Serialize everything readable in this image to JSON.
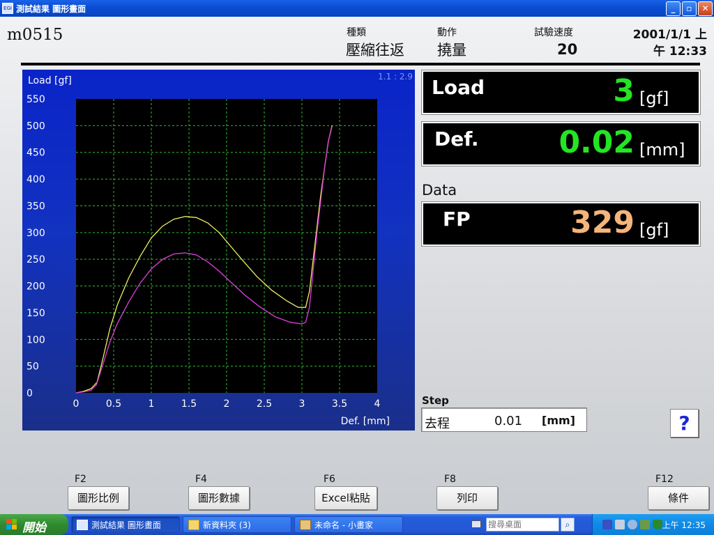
{
  "window": {
    "title": "測試結果  圖形畫面",
    "app_icon_text": "EGI",
    "minimize": "_",
    "restore": "▫",
    "close": "✕"
  },
  "header": {
    "sample_name": "m0515",
    "type_label": "種類",
    "type_value": "壓縮往返",
    "action_label": "動作",
    "action_value": "撓量",
    "speed_label": "試驗速度",
    "speed_value": "20",
    "date_line1": "2001/1/1 上",
    "date_line2": "午 12:33"
  },
  "chart_data": {
    "type": "line",
    "ylabel": "Load [gf]",
    "xlabel": "Def. [mm]",
    "ratio_label": "1.1 : 2.9",
    "ylim": [
      0,
      550
    ],
    "xlim": [
      0,
      4
    ],
    "yticks": [
      "0",
      "50",
      "100",
      "150",
      "200",
      "250",
      "300",
      "350",
      "400",
      "450",
      "500",
      "550"
    ],
    "xticks": [
      "0",
      "0.5",
      "1",
      "1.5",
      "2",
      "2.5",
      "3",
      "3.5",
      "4"
    ],
    "grid": true,
    "series": [
      {
        "color": "#f0f060",
        "x": [
          0,
          0.1,
          0.2,
          0.28,
          0.35,
          0.45,
          0.55,
          0.7,
          0.85,
          1.0,
          1.15,
          1.3,
          1.45,
          1.6,
          1.75,
          1.9,
          2.05,
          2.2,
          2.4,
          2.6,
          2.8,
          2.95,
          3.05,
          3.1,
          3.15,
          3.2,
          3.25,
          3.3,
          3.35,
          3.4
        ],
        "y": [
          0,
          3,
          8,
          20,
          60,
          120,
          165,
          215,
          255,
          290,
          312,
          325,
          330,
          328,
          318,
          300,
          275,
          250,
          218,
          192,
          172,
          160,
          160,
          190,
          250,
          310,
          370,
          420,
          470,
          500
        ]
      },
      {
        "color": "#e040e0",
        "x": [
          0,
          0.1,
          0.2,
          0.27,
          0.35,
          0.45,
          0.55,
          0.7,
          0.85,
          1.0,
          1.15,
          1.3,
          1.45,
          1.6,
          1.75,
          1.9,
          2.05,
          2.25,
          2.45,
          2.65,
          2.85,
          3.0,
          3.05,
          3.1,
          3.15,
          3.2,
          3.25,
          3.3,
          3.35,
          3.4
        ],
        "y": [
          0,
          2,
          5,
          15,
          50,
          95,
          130,
          170,
          205,
          232,
          250,
          260,
          262,
          258,
          245,
          228,
          208,
          182,
          160,
          142,
          132,
          129,
          132,
          160,
          230,
          300,
          360,
          420,
          470,
          498
        ]
      }
    ]
  },
  "readouts": {
    "load": {
      "name": "Load",
      "value": "3",
      "unit": "[gf]",
      "color": "#22e622"
    },
    "def": {
      "name": "Def.",
      "value": "0.02",
      "unit": "[mm]",
      "color": "#22e622"
    },
    "data_label": "Data",
    "fp": {
      "name": "FP",
      "value": "329",
      "unit": "[gf]",
      "color": "#f5b47a"
    }
  },
  "step": {
    "label": "Step",
    "direction": "去程",
    "value": "0.01",
    "unit": "[mm]"
  },
  "help": "?",
  "fkeys": [
    {
      "key": "F2",
      "label": "圖形比例"
    },
    {
      "key": "F4",
      "label": "圖形數據"
    },
    {
      "key": "F6",
      "label": "Excel粘貼"
    },
    {
      "key": "F8",
      "label": "列印"
    },
    {
      "key": "F12",
      "label": "條件"
    }
  ],
  "taskbar": {
    "start": "開始",
    "tasks": [
      "測試結果  圖形畫面",
      "新資料夾 (3)",
      "未命名 - 小畫家"
    ],
    "search_placeholder": "搜尋桌面",
    "clock": "上午 12:35"
  }
}
